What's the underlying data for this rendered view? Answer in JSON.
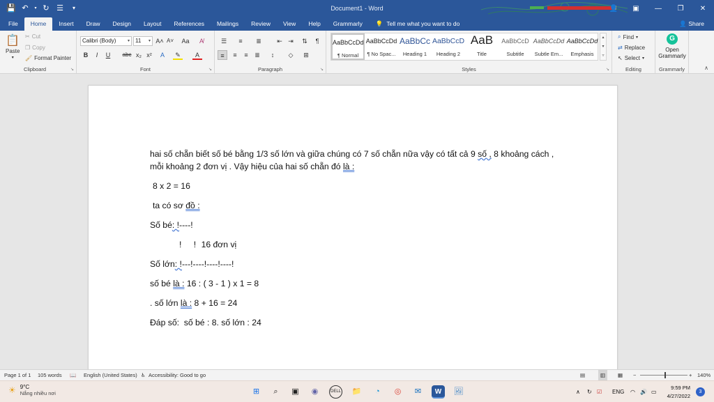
{
  "window": {
    "title": "Document1 - Word"
  },
  "tabs": [
    {
      "label": "File"
    },
    {
      "label": "Home"
    },
    {
      "label": "Insert"
    },
    {
      "label": "Draw"
    },
    {
      "label": "Design"
    },
    {
      "label": "Layout"
    },
    {
      "label": "References"
    },
    {
      "label": "Mailings"
    },
    {
      "label": "Review"
    },
    {
      "label": "View"
    },
    {
      "label": "Help"
    },
    {
      "label": "Grammarly"
    }
  ],
  "tell_me": "Tell me what you want to do",
  "share": "Share",
  "clipboard": {
    "paste": "Paste",
    "cut": "Cut",
    "copy": "Copy",
    "format_painter": "Format Painter",
    "label": "Clipboard"
  },
  "font": {
    "name": "Calibri (Body)",
    "size": "11",
    "case": "Aa",
    "label": "Font"
  },
  "paragraph": {
    "label": "Paragraph"
  },
  "styles": {
    "label": "Styles",
    "items": [
      {
        "preview": "AaBbCcDd",
        "name": "¶ Normal"
      },
      {
        "preview": "AaBbCcDd",
        "name": "¶ No Spac..."
      },
      {
        "preview": "AaBbCc",
        "name": "Heading 1"
      },
      {
        "preview": "AaBbCcD",
        "name": "Heading 2"
      },
      {
        "preview": "AaB",
        "name": "Title"
      },
      {
        "preview": "AaBbCcD",
        "name": "Subtitle"
      },
      {
        "preview": "AaBbCcDd",
        "name": "Subtle Em..."
      },
      {
        "preview": "AaBbCcDd",
        "name": "Emphasis"
      }
    ]
  },
  "editing": {
    "find": "Find",
    "replace": "Replace",
    "select": "Select",
    "label": "Editing"
  },
  "grammarly": {
    "open": "Open",
    "name": "Grammarly",
    "label": "Grammarly"
  },
  "document": {
    "line1a": "hai số chẵn biết số bé bằng 1/3 số lớn và giữa chúng có 7 số chẵn nữa vậy có tất cả 9 ",
    "line1b": "số ,",
    "line1c": " 8 khoảng cách ,",
    "line2a": "mỗi khoảng 2 đơn vị . Vậy hiệu của hai số chẵn đó ",
    "line2b": "là :",
    "line3": "8 x 2 = 16",
    "line4a": "ta có sơ ",
    "line4b": "đồ :",
    "line5a": "Số bé",
    "line5b": ": !",
    "line5c": "----!",
    "line6a": "!",
    "line6b": "!",
    "line6c": "16 đơn vị",
    "line7a": "Số lớn",
    "line7b": ": !",
    "line7c": "---!----!----!----!",
    "line8a": "số bé ",
    "line8b": "là :",
    "line8c": " 16 : ( 3 - 1 ) x 1 = 8",
    "line9a": ". số lớn ",
    "line9b": "là :",
    "line9c": " 8 + 16 = 24",
    "line10": "Đáp số:  số bé : 8. số lớn : 24"
  },
  "status": {
    "page": "Page 1 of 1",
    "words": "105 words",
    "language": "English (United States)",
    "accessibility": "Accessibility: Good to go",
    "zoom": "140%"
  },
  "taskbar": {
    "temp": "9°C",
    "weather": "Nắng nhiều nơi",
    "lang": "ENG",
    "time": "9:59 PM",
    "date": "4/27/2022",
    "notifications": "3"
  }
}
